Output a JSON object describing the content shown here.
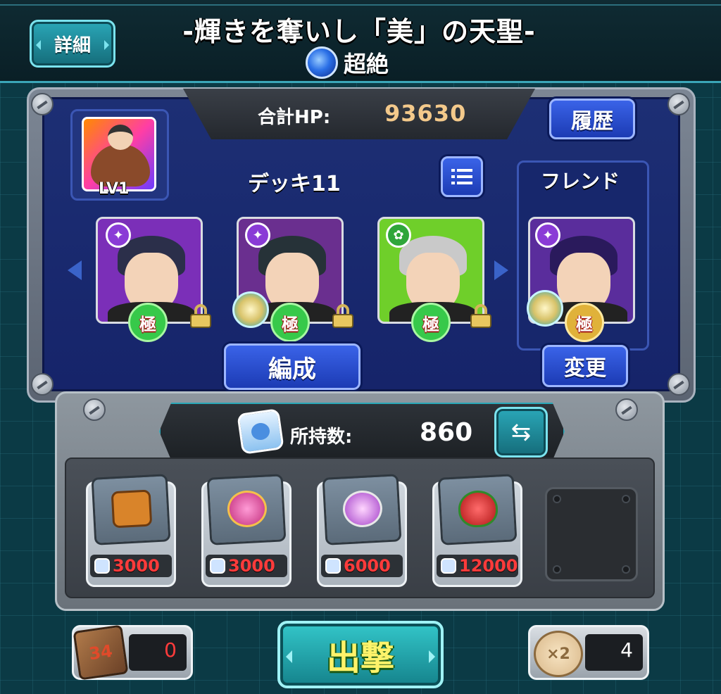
{
  "header": {
    "detail_label": "詳細",
    "quest_title": "-輝きを奪いし「美」の天聖-",
    "difficulty_label": "超絶"
  },
  "deck": {
    "hp_label": "合計HP:",
    "hp_value": "93630",
    "history_label": "履歴",
    "leader_level": "LV1",
    "deck_name": "デッキ11",
    "friend_label": "フレンド",
    "formation_label": "編成",
    "change_label": "変更",
    "kiwami_label": "極",
    "members": [
      {
        "element": "dark",
        "hair_color": "#2b2f4a",
        "bg": "#7b2fb8",
        "locked": true,
        "gauge": false
      },
      {
        "element": "dark",
        "hair_color": "#263238",
        "bg": "#6a2f8f",
        "locked": true,
        "gauge": true
      },
      {
        "element": "wood",
        "hair_color": "#c9c9c9",
        "bg": "#6fcf2a",
        "locked": true,
        "gauge": false
      },
      {
        "element": "dark",
        "hair_color": "#2a1a5c",
        "bg": "#5a2d9c",
        "locked": false,
        "gauge": true
      }
    ]
  },
  "shop": {
    "owned_label": "所持数:",
    "owned_value": "860",
    "items": [
      {
        "icon": "treasure-chest-icon",
        "price": "3000"
      },
      {
        "icon": "pink-orb-icon",
        "price": "3000"
      },
      {
        "icon": "purple-orb-icon",
        "price": "6000"
      },
      {
        "icon": "strawberry-heart-icon",
        "price": "12000"
      }
    ]
  },
  "bottom": {
    "dice_count": "0",
    "dice_faces": "34",
    "sortie_label": "出撃",
    "bonus_multiplier": "×2",
    "bonus_count": "4"
  },
  "colors": {
    "accent_teal": "#2aa7b7",
    "button_blue": "#3a63e8",
    "price_red": "#ff3b3b",
    "hp_gold": "#f3c98b",
    "sortie_yellow": "#fff36a"
  }
}
